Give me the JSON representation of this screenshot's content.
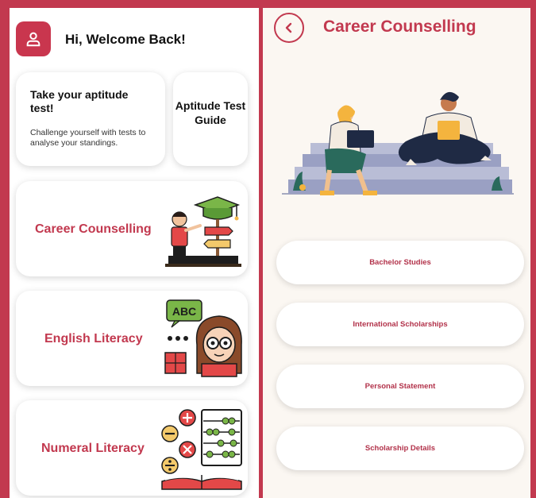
{
  "colors": {
    "accent": "#c2394f",
    "frame": "#c2394f",
    "card_bg": "#ffffff"
  },
  "home": {
    "greeting": "Hi, Welcome Back!",
    "avatar_icon": "user-icon",
    "aptitude_card": {
      "title": "Take your aptitude test!",
      "description": "Challenge yourself with tests to analyse your standings."
    },
    "guide_card": {
      "label": "Aptitude Test Guide"
    },
    "modules": [
      {
        "label": "Career Counselling",
        "icon": "career-signpost-icon"
      },
      {
        "label": "English Literacy",
        "icon": "abc-reading-girl-icon"
      },
      {
        "label": "Numeral Literacy",
        "icon": "abacus-math-icon"
      }
    ]
  },
  "career": {
    "title": "Career Counselling",
    "back_icon": "chevron-left-icon",
    "options": [
      {
        "label": "Bachelor Studies"
      },
      {
        "label": "International Scholarships"
      },
      {
        "label": "Personal Statement"
      },
      {
        "label": "Scholarship Details"
      }
    ]
  }
}
